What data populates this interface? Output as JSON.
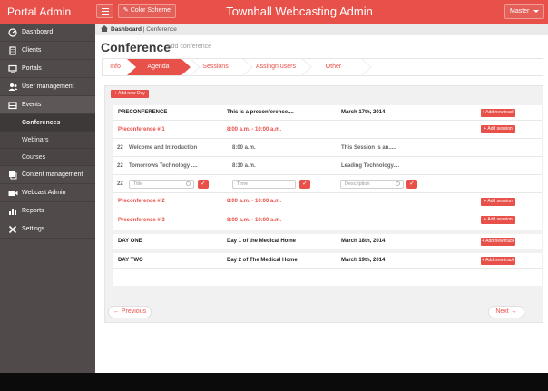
{
  "header": {
    "brand": "Portal Admin",
    "color_scheme": "Color Scheme",
    "title": "Townhall Webcasting  Admin",
    "user": "Master",
    "accent": "#e8504a"
  },
  "sidebar": {
    "items": [
      {
        "label": "Dashboard",
        "icon": "dashboard-icon"
      },
      {
        "label": "Clients",
        "icon": "building-icon"
      },
      {
        "label": "Portals",
        "icon": "monitor-icon"
      },
      {
        "label": "User management",
        "icon": "users-icon"
      },
      {
        "label": "Events",
        "icon": "inbox-icon"
      },
      {
        "label": "Content management",
        "icon": "layers-icon"
      },
      {
        "label": "Webcast Admin",
        "icon": "video-icon"
      },
      {
        "label": "Reports",
        "icon": "chart-icon"
      },
      {
        "label": "Settings",
        "icon": "tools-icon"
      }
    ],
    "events_sub": [
      "Conferences",
      "Webinars",
      "Courses"
    ]
  },
  "breadcrumb": {
    "home": "Dashboard",
    "current": "Conference"
  },
  "page": {
    "title": "Conference",
    "subtitle": "Add conference"
  },
  "tabs": [
    "Info",
    "Agenda",
    "Sessions",
    "Assingn users",
    "Other"
  ],
  "agenda": {
    "add_day": "+ Add new Day",
    "add_track": "+ Add new track",
    "add_session": "+ Add session",
    "rows": [
      {
        "name": "PRECONFERENCE",
        "desc": "This is a preconference....",
        "date": "March 17th, 2014"
      },
      {
        "name": "Preconference # 1",
        "time": "8:00 a.m. - 10:00 a.m."
      },
      {
        "num": "22",
        "title": "Welcome and Introduction",
        "time": "8:00 a.m.",
        "desc": "This Session is an....."
      },
      {
        "num": "22",
        "title": "Tomorrows Technology ....",
        "time": "8:30 a.m.",
        "desc": "Leading Technology...."
      },
      {
        "num": "22",
        "title_placeholder": "Title",
        "time_placeholder": "Time",
        "desc_placeholder": "Description"
      },
      {
        "name": "Preconference # 2",
        "time": "8:00 a.m. - 10:00 a.m."
      },
      {
        "name": "Preconference # 3",
        "time": "8:00 a.m. - 10:00 a.m."
      },
      {
        "name": "DAY ONE",
        "desc": "Day 1 of the Medical Home",
        "date": "March 18th, 2014"
      },
      {
        "name": "DAY TWO",
        "desc": "Day 2 of The Medical Home",
        "date": "March 19th, 2014"
      }
    ]
  },
  "pager": {
    "prev": "← Previous",
    "next": "Next →"
  }
}
